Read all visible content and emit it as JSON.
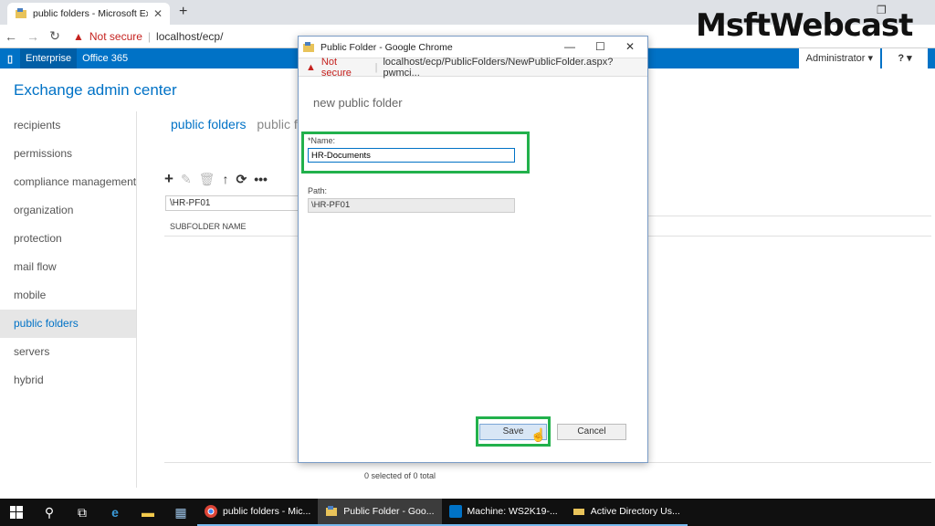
{
  "browser": {
    "tab_title": "public folders - Microsoft Exchan",
    "not_secure": "Not secure",
    "url": "localhost/ecp/"
  },
  "ecp": {
    "nav_enterprise": "Enterprise",
    "nav_office365": "Office 365",
    "admin": "Administrator ▾",
    "help": "? ▾",
    "app_title": "Exchange admin center",
    "left_nav": [
      "recipients",
      "permissions",
      "compliance management",
      "organization",
      "protection",
      "mail flow",
      "mobile",
      "public folders",
      "servers",
      "hybrid"
    ],
    "tab_public_folders": "public folders",
    "tab_public_fo": "public fo",
    "path": "\\HR-PF01",
    "column_subfolder": "SUBFOLDER NAME",
    "status": "0 selected of 0 total"
  },
  "popup": {
    "window_title": "Public Folder - Google Chrome",
    "not_secure": "Not secure",
    "url": "localhost/ecp/PublicFolders/NewPublicFolder.aspx?pwmci...",
    "heading": "new public folder",
    "name_label": "*Name:",
    "name_value": "HR-Documents",
    "path_label": "Path:",
    "path_value": "\\HR-PF01",
    "save": "Save",
    "cancel": "Cancel"
  },
  "watermark": "MsftWebcast",
  "taskbar": {
    "apps": [
      "public folders - Mic...",
      "Public Folder - Goo...",
      "Machine: WS2K19-...",
      "Active Directory Us..."
    ]
  },
  "colors": {
    "accent": "#0072c6",
    "highlight": "#22b14c"
  }
}
